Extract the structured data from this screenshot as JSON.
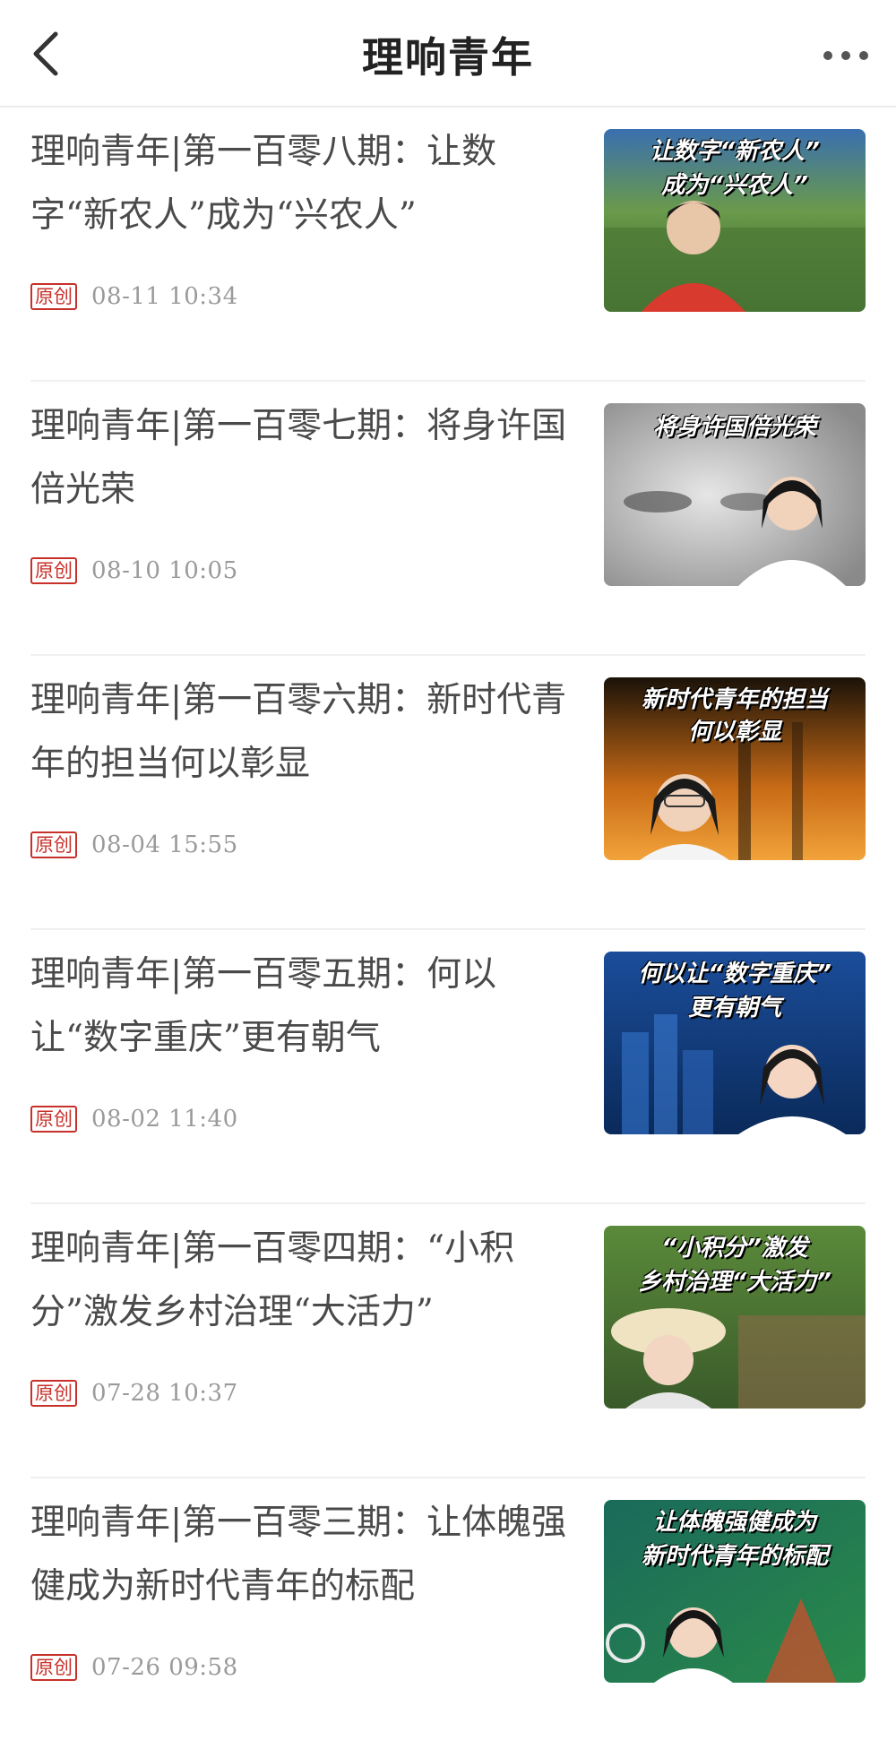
{
  "header": {
    "title": "理响青年",
    "back_icon": "chevron-left-icon",
    "more_icon": "more-dots-icon"
  },
  "articles": [
    {
      "title": "理响青年|第一百零八期：让数字“新农人”成为“兴农人”",
      "badge": "原创",
      "time": "08-11  10:34",
      "thumb_lines": [
        "让数字“新农人”",
        "成为“兴农人”"
      ]
    },
    {
      "title": "理响青年|第一百零七期：将身许国倍光荣",
      "badge": "原创",
      "time": "08-10  10:05",
      "thumb_lines": [
        "将身许国倍光荣"
      ]
    },
    {
      "title": "理响青年|第一百零六期：新时代青年的担当何以彰显",
      "badge": "原创",
      "time": "08-04  15:55",
      "thumb_lines": [
        "新时代青年的担当",
        "何以彰显"
      ]
    },
    {
      "title": "理响青年|第一百零五期：何以让“数字重庆”更有朝气",
      "badge": "原创",
      "time": "08-02  11:40",
      "thumb_lines": [
        "何以让“数字重庆”",
        "更有朝气"
      ]
    },
    {
      "title": "理响青年|第一百零四期：“小积分”激发乡村治理“大活力”",
      "badge": "原创",
      "time": "07-28  10:37",
      "thumb_lines": [
        "“小积分”激发",
        "乡村治理“大活力”"
      ]
    },
    {
      "title": "理响青年|第一百零三期：让体魄强健成为新时代青年的标配",
      "badge": "原创",
      "time": "07-26  09:58",
      "thumb_lines": [
        "让体魄强健成为",
        "新时代青年的标配"
      ]
    }
  ]
}
